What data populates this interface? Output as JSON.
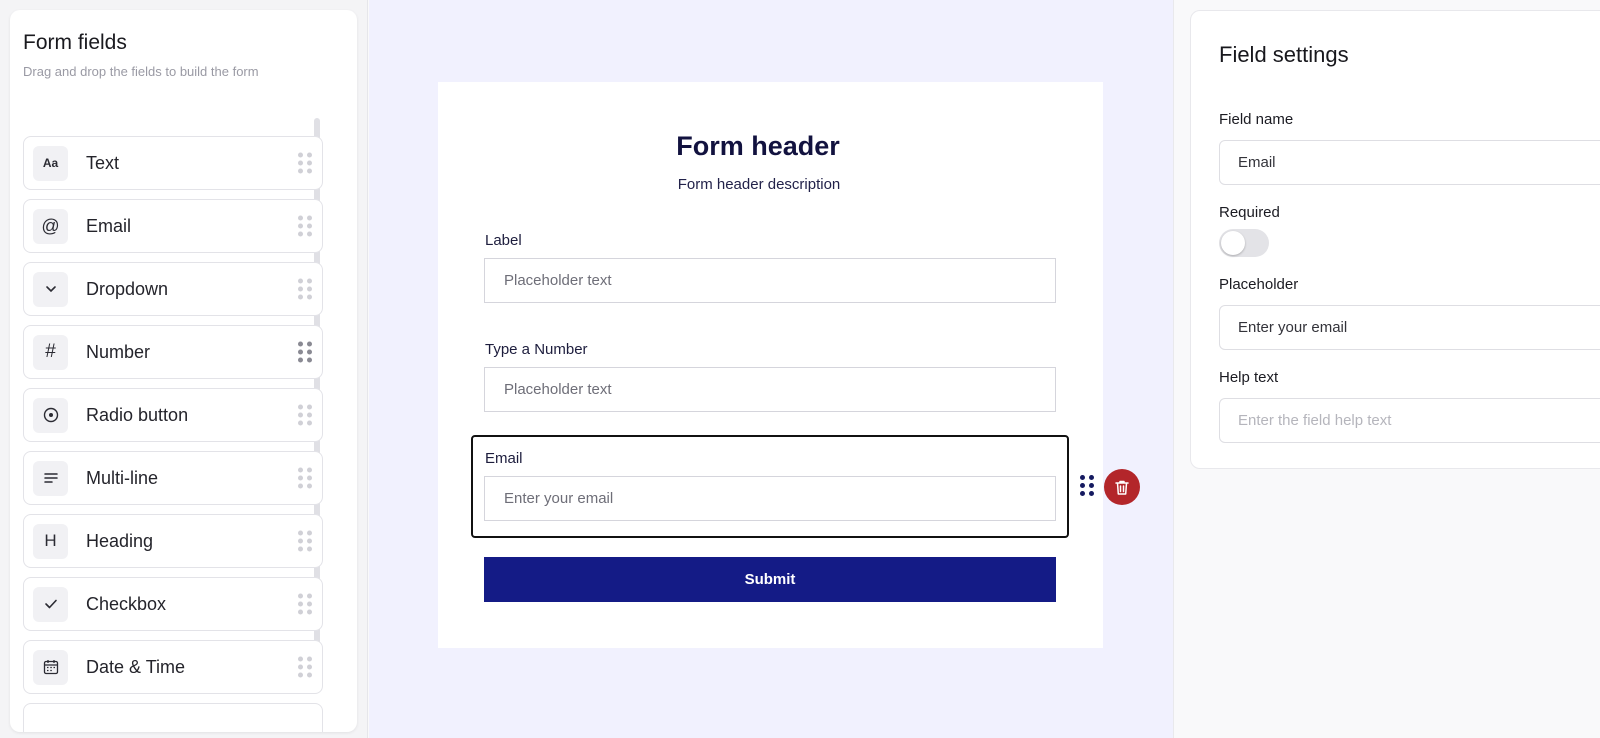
{
  "form_fields_panel": {
    "title": "Form fields",
    "subtitle": "Drag and drop the fields to build the form",
    "items": [
      {
        "label": "Text",
        "icon": "text-format-icon",
        "glyph": "Aa"
      },
      {
        "label": "Email",
        "icon": "at-sign-icon",
        "glyph": "@"
      },
      {
        "label": "Dropdown",
        "icon": "chevron-down-icon",
        "glyph": "⌄"
      },
      {
        "label": "Number",
        "icon": "hash-icon",
        "glyph": "#"
      },
      {
        "label": "Radio button",
        "icon": "radio-icon",
        "glyph": "⊙"
      },
      {
        "label": "Multi-line",
        "icon": "multiline-icon",
        "glyph": "≡"
      },
      {
        "label": "Heading",
        "icon": "heading-icon",
        "glyph": "H"
      },
      {
        "label": "Checkbox",
        "icon": "check-icon",
        "glyph": "✓"
      },
      {
        "label": "Date & Time",
        "icon": "calendar-icon",
        "glyph": "▦"
      }
    ]
  },
  "form": {
    "title": "Form header",
    "description": "Form header description",
    "fields": [
      {
        "label": "Label",
        "placeholder": "Placeholder text"
      },
      {
        "label": "Type a Number",
        "placeholder": "Placeholder text"
      },
      {
        "label": "Email",
        "placeholder": "Enter your email"
      }
    ],
    "submit_label": "Submit"
  },
  "field_settings": {
    "title": "Field settings",
    "field_name_label": "Field name",
    "field_name_value": "Email",
    "required_label": "Required",
    "required": false,
    "placeholder_label": "Placeholder",
    "placeholder_value": "Enter your email",
    "help_text_label": "Help text",
    "help_text_placeholder": "Enter the field help text"
  },
  "colors": {
    "canvas_bg": "#f1f1fe",
    "submit_bg": "#141b86",
    "delete_bg": "#b3262a",
    "heading_text": "#12123f"
  }
}
